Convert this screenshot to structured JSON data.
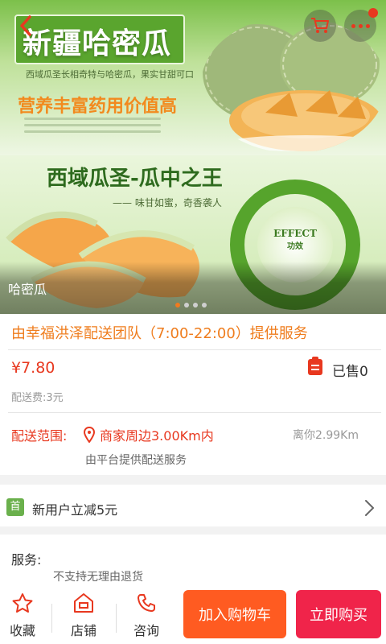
{
  "banner": {
    "headline": "新疆哈密瓜",
    "subtext": "西域瓜圣长相奇特与哈密瓜，果实甘甜可口",
    "slogan": "营养丰富药用价值高",
    "headline2": "西域瓜圣-瓜中之王",
    "subtext2": "—— 味甘如蜜，奇香袭人",
    "effect_label": "EFFECT",
    "effect_sub": "功效",
    "caption": "哈密瓜",
    "slide_count": 4,
    "active_slide": 1
  },
  "topbar": {
    "back_icon": "chevron-left-icon",
    "cart_icon": "shopping-cart-icon",
    "more_icon": "more-dots-icon"
  },
  "product": {
    "title": "由幸福洪泽配送团队（7:00-22:00）提供服务",
    "price": "¥7.80",
    "sold": "已售0",
    "delivery_fee": "配送费:3元",
    "range_label": "配送范围:",
    "range_value": "商家周边3.00Km内",
    "distance": "离你2.99Km",
    "delivery_note": "由平台提供配送服务"
  },
  "promo": {
    "tag": "首",
    "text": "新用户立减5元"
  },
  "service": {
    "label": "服务:",
    "item": "不支持无理由退货"
  },
  "bottom_bar": {
    "favorite": "收藏",
    "shop": "店铺",
    "consult": "咨询",
    "add_to_cart": "加入购物车",
    "buy_now": "立即购买"
  },
  "colors": {
    "accent_orange": "#ef7d1e",
    "price_red": "#e8381f",
    "cart_button": "#ff5b21",
    "buy_button": "#f0244a",
    "promo_green": "#6ab04c"
  }
}
